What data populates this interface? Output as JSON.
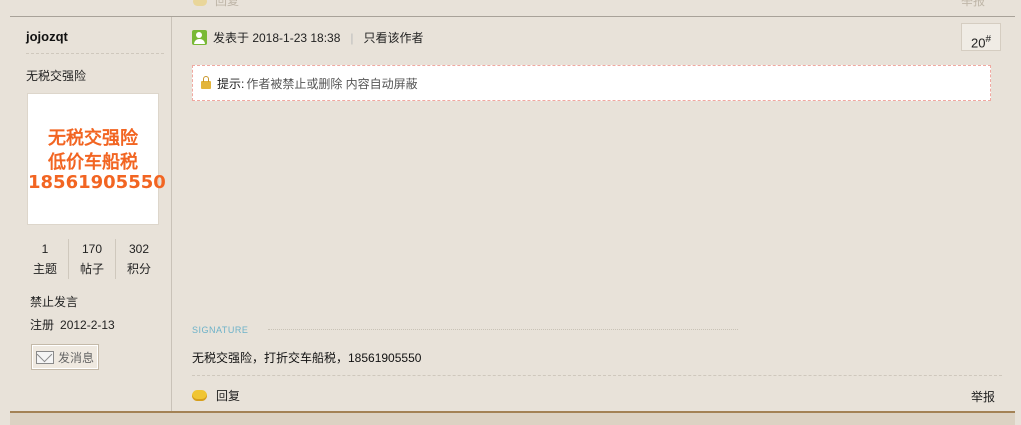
{
  "ghost": {
    "reply": "回复",
    "report": "举报"
  },
  "user": {
    "name": "jojozqt",
    "custom_title": "无税交强险",
    "avatar_lines": [
      "无税交强险",
      "低价车船税",
      "18561905550"
    ],
    "stats": [
      {
        "value": "1",
        "label": "主题"
      },
      {
        "value": "170",
        "label": "帖子"
      },
      {
        "value": "302",
        "label": "积分"
      }
    ],
    "status": "禁止发言",
    "register_label": "注册",
    "register_date": "2012-2-13",
    "pm_button": "发消息"
  },
  "post": {
    "posted_label": "发表于 2018-1-23 18:38",
    "only_author": "只看该作者",
    "floor": "20",
    "floor_mark": "#",
    "notice_key": "提示:",
    "notice_value": "作者被禁止或删除 内容自动屏蔽",
    "signature_label": "SIGNATURE",
    "signature_text": "无税交强险，打折交车船税，18561905550",
    "reply": "回复",
    "report": "举报"
  },
  "colors": {
    "background": "#e8e2d9",
    "avatar_text": "#f26522",
    "signature_label": "#6db2c9",
    "bottom_border": "#a38255"
  }
}
